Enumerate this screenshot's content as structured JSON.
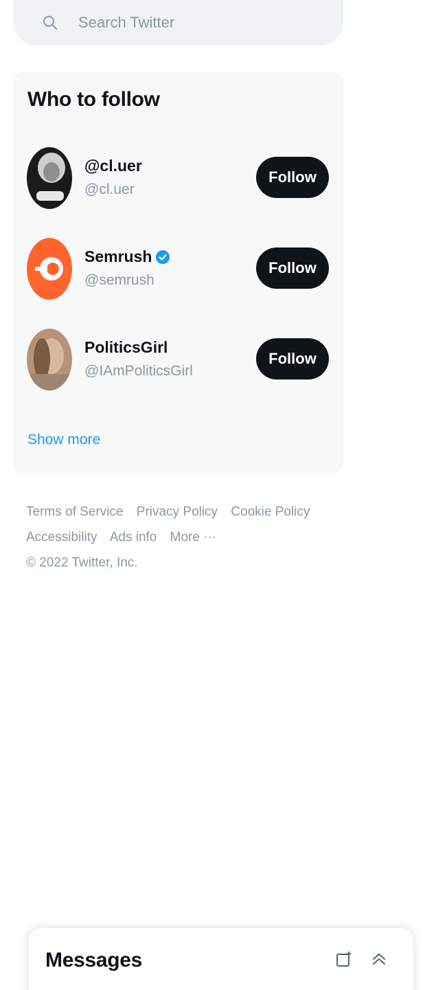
{
  "search": {
    "placeholder": "Search Twitter",
    "icon": "search-icon"
  },
  "who_to_follow": {
    "title": "Who to follow",
    "accounts": [
      {
        "name": "@cl.uer",
        "handle": "@cl.uer",
        "verified": false,
        "button": "Follow"
      },
      {
        "name": "Semrush",
        "handle": "@semrush",
        "verified": true,
        "button": "Follow"
      },
      {
        "name": "PoliticsGirl",
        "handle": "@IAmPoliticsGirl",
        "verified": false,
        "button": "Follow"
      }
    ],
    "show_more": "Show more"
  },
  "footer": {
    "links_line1": [
      "Terms of Service",
      "Privacy Policy",
      "Cookie Policy"
    ],
    "links_line2": [
      "Accessibility",
      "Ads info",
      "More ···"
    ],
    "copyright": "© 2022 Twitter, Inc."
  },
  "messages": {
    "title": "Messages",
    "icons": [
      "new-message-icon",
      "collapse-chevron-icon"
    ]
  },
  "colors": {
    "accent": "#1d9bf0",
    "button_bg": "#0f1419",
    "panel_bg": "#f7f9f9",
    "semrush": "#ff642d"
  }
}
